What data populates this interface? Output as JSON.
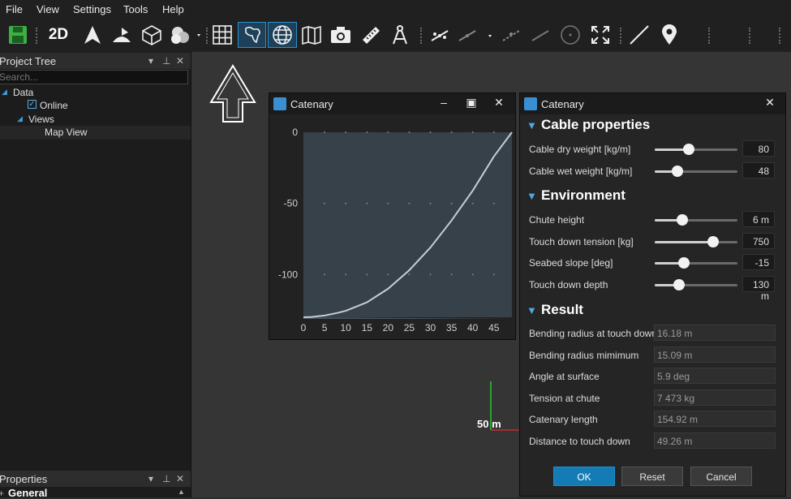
{
  "menu": [
    "File",
    "View",
    "Settings",
    "Tools",
    "Help"
  ],
  "toolbar": {
    "mode_2d": "2D",
    "icons": [
      "save-icon",
      "2d-mode-icon",
      "north-arrow-icon",
      "terrain-icon",
      "3d-cube-icon",
      "layers-icon",
      "grid-icon",
      "world-map-icon",
      "globe-icon",
      "map-book-icon",
      "camera-icon",
      "ruler-icon",
      "compass-tool-icon",
      "line-tool-icon",
      "polyline-tool-icon",
      "dashed-line-icon",
      "disabled-line-icon",
      "circle-tool-icon",
      "fullscreen-icon",
      "draw-line-icon",
      "map-pin-icon"
    ]
  },
  "project_tree": {
    "title": "Project Tree",
    "search_placeholder": "Search...",
    "items": [
      {
        "label": "Data",
        "level": 0
      },
      {
        "label": "Online",
        "level": 1,
        "checked": true
      },
      {
        "label": "Views",
        "level": 1
      },
      {
        "label": "Map View",
        "level": 2
      }
    ]
  },
  "properties_panel": {
    "title": "Properties",
    "general": "General"
  },
  "viewport": {
    "scale_label": "50 m"
  },
  "chart_window": {
    "title": "Catenary",
    "chart_data": {
      "type": "line",
      "x_ticks": [
        0,
        5,
        10,
        15,
        20,
        25,
        30,
        35,
        40,
        45
      ],
      "y_ticks": [
        0,
        -50,
        -100
      ],
      "xlim": [
        0,
        49.26
      ],
      "ylim": [
        -130,
        0
      ],
      "grid": true,
      "series": [
        {
          "x": [
            0,
            2,
            5,
            8,
            10,
            15,
            20,
            25,
            30,
            35,
            40,
            45,
            49.26
          ],
          "values": [
            -130,
            -129.8,
            -128.8,
            -127,
            -125.5,
            -119.5,
            -110,
            -97,
            -81,
            -62,
            -41,
            -17,
            0
          ]
        }
      ]
    }
  },
  "catenary_dialog": {
    "title": "Catenary",
    "sections": {
      "cable": "Cable properties",
      "environment": "Environment",
      "result": "Result"
    },
    "cable_rows": [
      {
        "label": "Cable dry weight [kg/m]",
        "value": "80",
        "level": 0.41
      },
      {
        "label": "Cable wet weight [kg/m]",
        "value": "48",
        "level": 0.27
      }
    ],
    "environment_rows": [
      {
        "label": "Chute height",
        "value": "6 m",
        "level": 0.33
      },
      {
        "label": "Touch down tension [kg]",
        "value": "750",
        "level": 0.71
      },
      {
        "label": "Seabed slope [deg]",
        "value": "-15",
        "level": 0.35
      },
      {
        "label": "Touch down depth",
        "value": "130 m",
        "level": 0.29
      }
    ],
    "result_rows": [
      {
        "label": "Bending radius at touch down",
        "value": "16.18 m"
      },
      {
        "label": "Bending radius mimimum",
        "value": "15.09 m"
      },
      {
        "label": "Angle at surface",
        "value": "5.9 deg"
      },
      {
        "label": "Tension at chute",
        "value": "7 473 kg"
      },
      {
        "label": "Catenary length",
        "value": "154.92 m"
      },
      {
        "label": "Distance to touch down",
        "value": "49.26 m"
      }
    ],
    "buttons": {
      "ok": "OK",
      "reset": "Reset",
      "cancel": "Cancel"
    }
  },
  "colors": {
    "accent": "#2a8fcf",
    "curve": "#c7ccd1",
    "save": "#3cb043"
  }
}
